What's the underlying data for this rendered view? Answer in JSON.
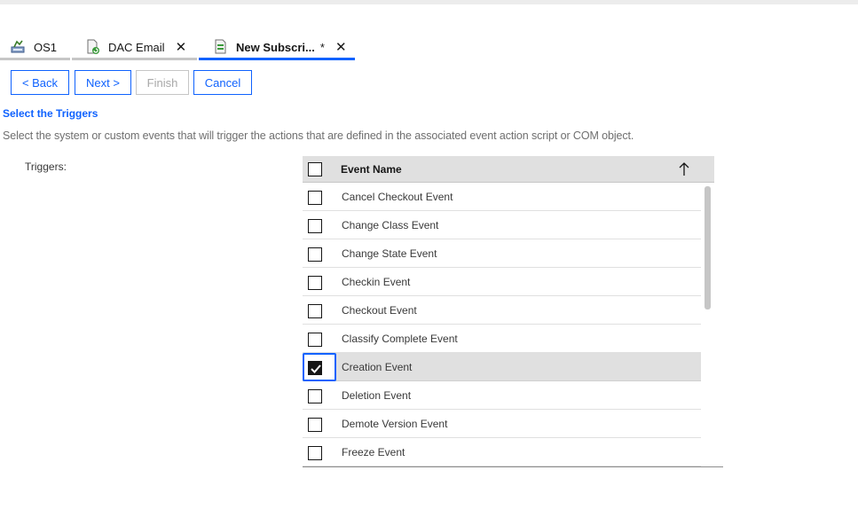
{
  "tabs": [
    {
      "label": "OS1",
      "icon": "object-store-icon",
      "closable": false,
      "active": false
    },
    {
      "label": "DAC Email",
      "icon": "email-document-icon",
      "closable": true,
      "active": false
    },
    {
      "label": "New Subscri...",
      "dirty": "*",
      "icon": "subscription-icon",
      "closable": true,
      "active": true
    }
  ],
  "buttons": {
    "back": "< Back",
    "next": "Next >",
    "finish": "Finish",
    "cancel": "Cancel"
  },
  "section": {
    "title": "Select the Triggers",
    "description": "Select the system or custom events that will trigger the actions that are defined in the associated event action script or COM object."
  },
  "triggers_label": "Triggers:",
  "grid": {
    "column_header": "Event Name",
    "sort": "ascending",
    "rows": [
      {
        "label": "Cancel Checkout Event",
        "checked": false
      },
      {
        "label": "Change Class Event",
        "checked": false
      },
      {
        "label": "Change State Event",
        "checked": false
      },
      {
        "label": "Checkin Event",
        "checked": false
      },
      {
        "label": "Checkout Event",
        "checked": false
      },
      {
        "label": "Classify Complete Event",
        "checked": false
      },
      {
        "label": "Creation Event",
        "checked": true
      },
      {
        "label": "Deletion Event",
        "checked": false
      },
      {
        "label": "Demote Version Event",
        "checked": false
      },
      {
        "label": "Freeze Event",
        "checked": false
      }
    ]
  },
  "colors": {
    "accent": "#0f62fe",
    "selected_row": "#e0e0e0"
  }
}
